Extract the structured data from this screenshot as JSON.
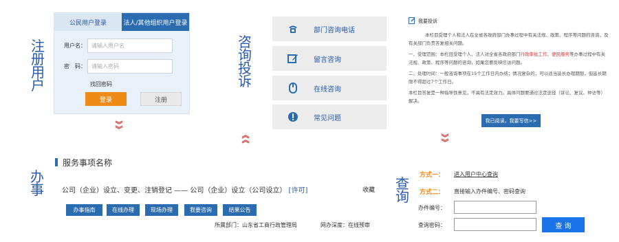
{
  "sections": {
    "register": "注册用户",
    "consult": "咨询投诉",
    "handle": "办事",
    "query": "查询"
  },
  "login": {
    "tab_personal": "公民用户登录",
    "tab_corporate": "法人/其他组织用户登录",
    "username_label": "用户名：",
    "username_placeholder": "请输入用户名",
    "password_label": "密　码：",
    "password_placeholder": "请输入密码",
    "forgot": "找回密码",
    "login_btn": "登录",
    "register_btn": "注册"
  },
  "consult": {
    "items": [
      {
        "label": "部门咨询电话",
        "icon": "phone-icon"
      },
      {
        "label": "留言咨询",
        "icon": "edit-icon"
      },
      {
        "label": "在线咨询",
        "icon": "mouse-icon"
      },
      {
        "label": "常见问题",
        "icon": "alert-icon"
      }
    ]
  },
  "complaint": {
    "title": "我要投诉",
    "p1": "本栏目受理个人和法人在全省各政府部门办事过程中有关法规、政策、程序等问题的咨询，及有关部门负责答复相关问题。",
    "p2a": "一、受理范围：本栏目受理个人、法人对全省各政府部门",
    "p2b": "行政审批工作、便民服务",
    "p2c": "等办事过程中有关法规、政策、程序等问题的咨询，如果您要反映信访问题。",
    "p3": "二、处理时间：一般咨询事项在15个工作日内办结；情况复杂的，可以适当延长办理期限，但延长期限不得超过7个工作日。",
    "p4": "本栏目答复是一种指导性意见，不具有法定效力。具体问题要通过法定途径（诉讼、复议、仲访等）解决。",
    "read_btn": "我已阅读，我要写信>>"
  },
  "service": {
    "heading": "服务事项名称",
    "item_title": "公司（企业）设立、变更、注销登记 —— 公司（企业）设立（公司设立）",
    "permit": "[许可]",
    "collect": "收藏",
    "buttons": [
      "办事指南",
      "在线办理",
      "现场办理",
      "我要咨询",
      "结果公告"
    ],
    "dept": "所属部门：山东省工商行政管理局",
    "depth": "网办深度：在线预审"
  },
  "query": {
    "method1_label": "方式一：",
    "method1_text": "进入用户中心查询",
    "method2_label": "方式二：",
    "method2_text": "直接输入办件编号、密码查询",
    "number_label": "办件编号：",
    "password_label": "查询密码：",
    "query_btn": "查 询"
  },
  "colors": {
    "accent": "#2b6cb0",
    "orange": "#f08a16",
    "red": "#d23a3a"
  }
}
